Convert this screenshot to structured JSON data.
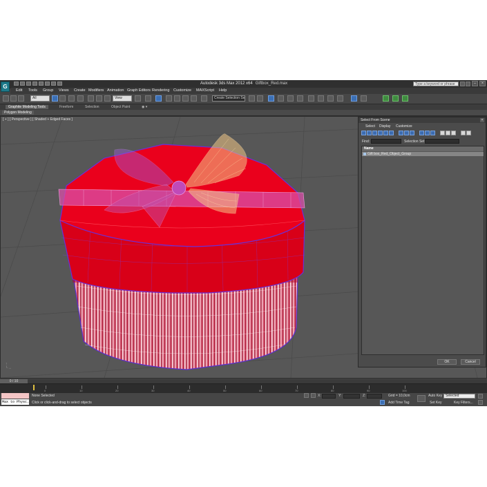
{
  "app": {
    "title": "Autodesk 3ds Max  2012 x64",
    "file": "Giftbox_Red.max",
    "search_placeholder": "Type a keyword or phrase"
  },
  "menu": [
    "Edit",
    "Tools",
    "Group",
    "Views",
    "Create",
    "Modifiers",
    "Animation",
    "Graph Editors",
    "Rendering",
    "Customize",
    "MAXScript",
    "Help"
  ],
  "toolbar": {
    "filter_value": "All",
    "refcoord_value": "View",
    "selection_set_value": "Create Selection Se"
  },
  "ribbon": {
    "tabs": [
      "Graphite Modeling Tools",
      "Freeform",
      "Selection",
      "Object Paint"
    ],
    "panel": "Polygon Modeling"
  },
  "viewport": {
    "label": "[ + ] [ Perspective ] [ Shaded + Edged Faces ]"
  },
  "dialog": {
    "title": "Select From Scene",
    "menu": [
      "Select",
      "Display",
      "Customize"
    ],
    "find_label": "Find:",
    "selection_set_label": "Selection Set:",
    "column_name": "Name",
    "rows": [
      "Gift box_Red_Object_Group"
    ],
    "ok_label": "OK",
    "cancel_label": "Cancel"
  },
  "timeline": {
    "frame_label": "0 / 10",
    "ticks": [
      "0",
      "10",
      "20",
      "30",
      "40",
      "50",
      "60",
      "70",
      "80",
      "90",
      "100"
    ]
  },
  "status": {
    "maxscript": "Max to Physc.",
    "selection_text": "None Selected",
    "prompt_text": "Click or click-and-drag to select objects",
    "x_label": "X:",
    "y_label": "Y:",
    "z_label": "Z:",
    "grid_text": "Grid = 10,0cm",
    "add_time_tag": "Add Time Tag",
    "auto_key": "Auto Key",
    "set_key": "Set Key",
    "selected_value": "Selected",
    "key_filters": "Key Filters..."
  },
  "colors": {
    "box_lid": "#e8001a",
    "box_body": "#d94c6c",
    "ribbon_pink": "#d25aa8",
    "bow_yellow": "#f2c87a",
    "viewport_bg": "#575757",
    "selection_blue": "#3b6fb4"
  }
}
